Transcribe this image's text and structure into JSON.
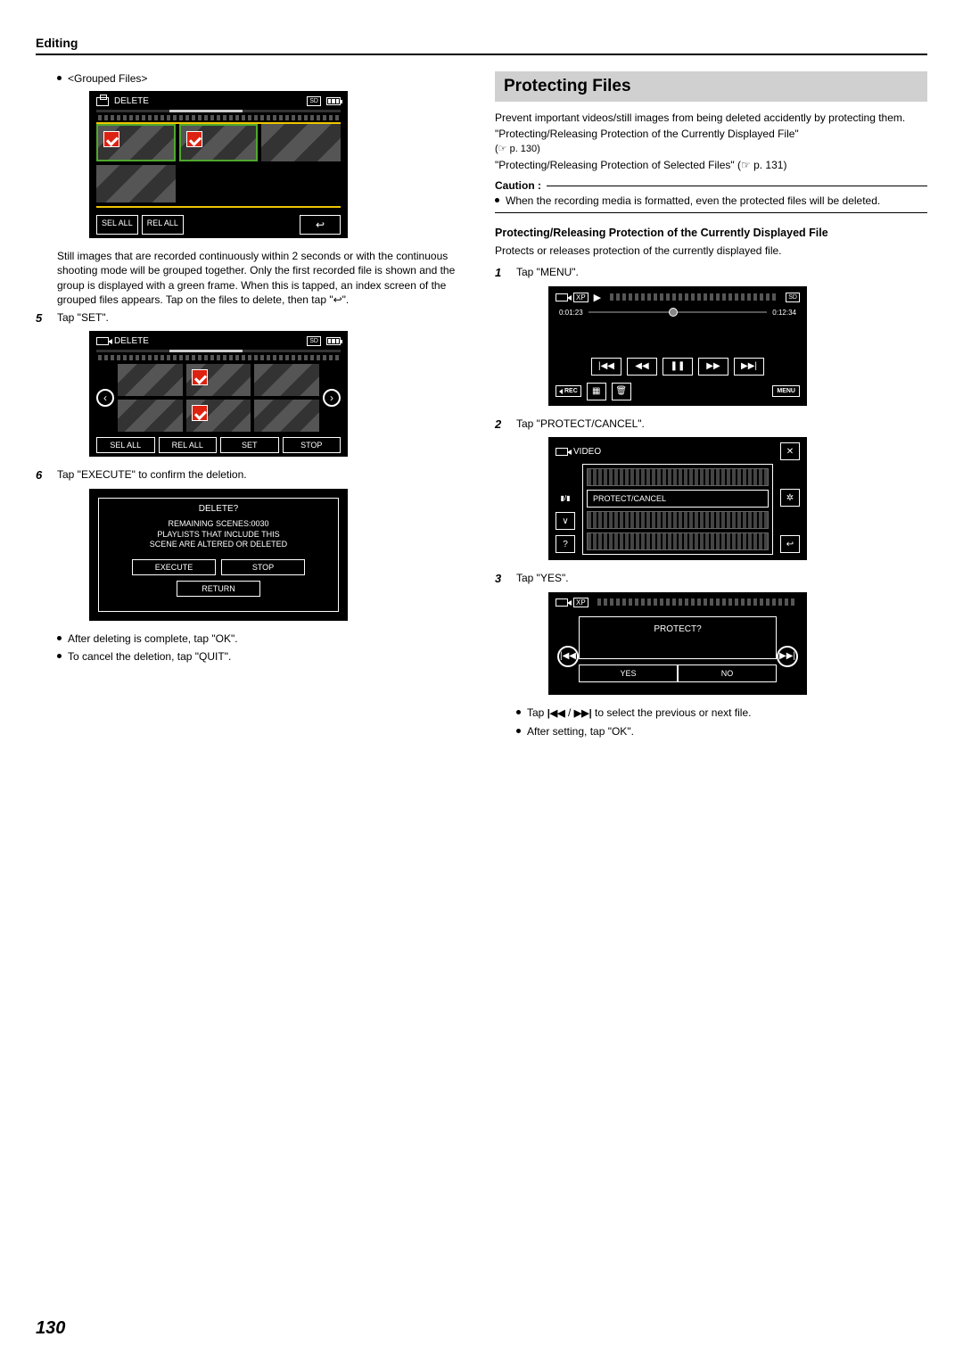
{
  "header": {
    "title": "Editing"
  },
  "page_number": "130",
  "left": {
    "grouped_label": "<Grouped Files>",
    "screen1": {
      "title": "DELETE",
      "sel_all": "SEL ALL",
      "rel_all": "REL ALL"
    },
    "grouped_note": "Still images that are recorded continuously within 2 seconds or with the continuous shooting mode will be grouped together. Only the first recorded file is shown and the group is displayed with a green frame. When this is tapped, an index screen of the grouped files appears. Tap on the files to delete, then tap \"↩\".",
    "step5_num": "5",
    "step5_text": "Tap \"SET\".",
    "screen2": {
      "title": "DELETE",
      "sel_all": "SEL ALL",
      "rel_all": "REL ALL",
      "set": "SET",
      "stop": "STOP"
    },
    "step6_num": "6",
    "step6_text": "Tap \"EXECUTE\" to confirm the deletion.",
    "screen3": {
      "title": "DELETE?",
      "line1": "REMAINING SCENES:0030",
      "line2": "PLAYLISTS THAT INCLUDE THIS",
      "line3": "SCENE ARE ALTERED OR DELETED",
      "execute": "EXECUTE",
      "stop": "STOP",
      "return": "RETURN"
    },
    "after1": "After deleting is complete, tap \"OK\".",
    "after2": "To cancel the deletion, tap \"QUIT\"."
  },
  "right": {
    "section_title": "Protecting Files",
    "intro": "Prevent important videos/still images from being deleted accidently by protecting them.",
    "ref1": "\"Protecting/Releasing Protection of the Currently Displayed File\"",
    "ref1_page": "(☞ p. 130)",
    "ref2": "\"Protecting/Releasing Protection of Selected Files\" (☞ p. 131)",
    "caution_label": "Caution :",
    "caution_text": "When the recording media is formatted, even the protected files will be deleted.",
    "sub_head": "Protecting/Releasing Protection of the Currently Displayed File",
    "sub_text": "Protects or releases protection of the currently displayed file.",
    "step1_num": "1",
    "step1_text": "Tap \"MENU\".",
    "screen_pb": {
      "xp": "XP",
      "t1": "0:01:23",
      "t2": "0:12:34",
      "rec": "REC",
      "menu": "MENU"
    },
    "step2_num": "2",
    "step2_text": "Tap \"PROTECT/CANCEL\".",
    "screen_menu": {
      "title": "VIDEO",
      "item": "PROTECT/CANCEL"
    },
    "step3_num": "3",
    "step3_text": "Tap \"YES\".",
    "screen_prot": {
      "xp": "XP",
      "title": "PROTECT?",
      "yes": "YES",
      "no": "NO"
    },
    "tail1_a": "Tap ",
    "tail1_b": " / ",
    "tail1_c": " to select the previous or next file.",
    "tail2": "After setting, tap \"OK\"."
  }
}
